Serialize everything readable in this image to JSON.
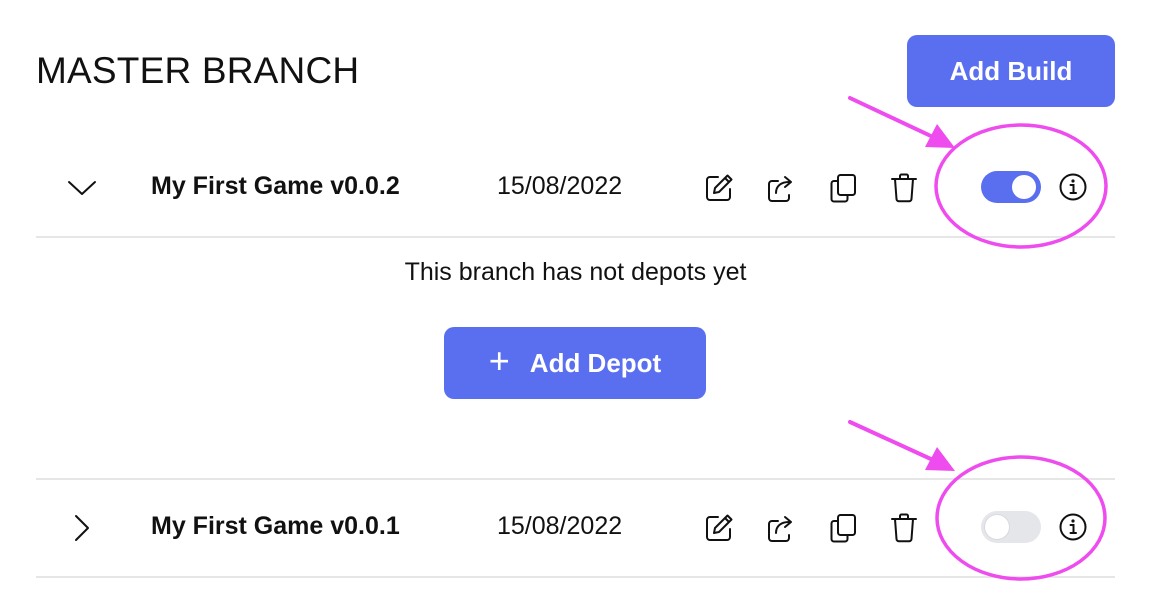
{
  "colors": {
    "accent": "#5a6ff0",
    "annotation": "#ee4cee"
  },
  "header": {
    "title": "MASTER BRANCH",
    "add_build_label": "Add Build"
  },
  "builds": [
    {
      "name": "My First Game v0.0.2",
      "date": "15/08/2022",
      "expanded": true,
      "enabled": true,
      "actions": [
        "edit-icon",
        "share-icon",
        "copy-icon",
        "trash-icon"
      ]
    },
    {
      "name": "My First Game v0.0.1",
      "date": "15/08/2022",
      "expanded": false,
      "enabled": false,
      "actions": [
        "edit-icon",
        "share-icon",
        "copy-icon",
        "trash-icon"
      ]
    }
  ],
  "depots": {
    "empty_message": "This branch has not depots yet",
    "add_depot_label": "Add Depot",
    "add_depot_icon": "plus-icon"
  }
}
